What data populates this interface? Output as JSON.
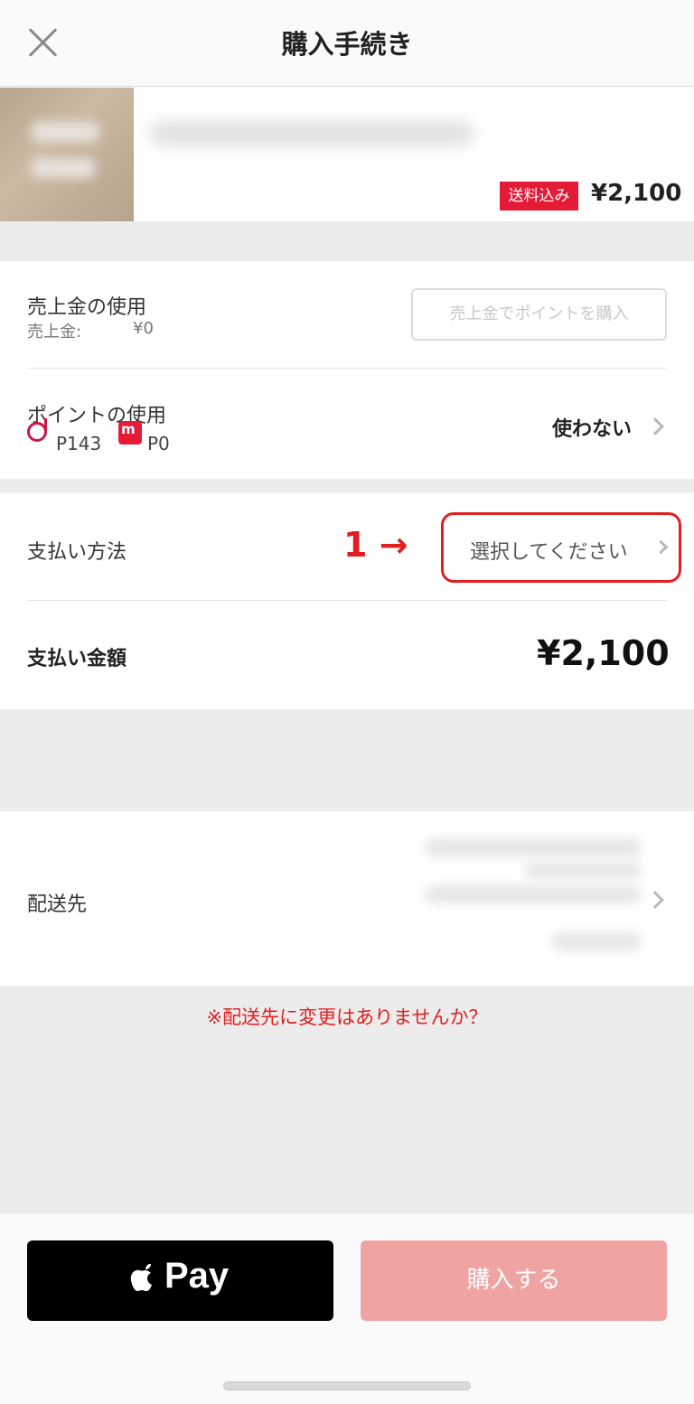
{
  "header": {
    "title": "購入手続き"
  },
  "item": {
    "shipping_badge": "送料込み",
    "price": "¥2,100"
  },
  "sales": {
    "label": "売上金の使用",
    "balance_label": "売上金:",
    "balance_value": "¥0",
    "buy_points_label": "売上金でポイントを購入"
  },
  "points": {
    "label": "ポイントの使用",
    "d_points": "P143",
    "m_points": "P0",
    "selected_value": "使わない"
  },
  "payment": {
    "label": "支払い方法",
    "annotation": "1 →",
    "select_placeholder": "選択してください"
  },
  "total": {
    "label": "支払い金額",
    "value": "¥2,100"
  },
  "shipping": {
    "label": "配送先",
    "warning": "※配送先に変更はありませんか？"
  },
  "actions": {
    "apple_pay_label": "Pay",
    "purchase_label": "購入する"
  },
  "colors": {
    "accent_red": "#e41a37",
    "purchase_disabled": "#f0a3a3",
    "annotation_red": "#e02020"
  }
}
